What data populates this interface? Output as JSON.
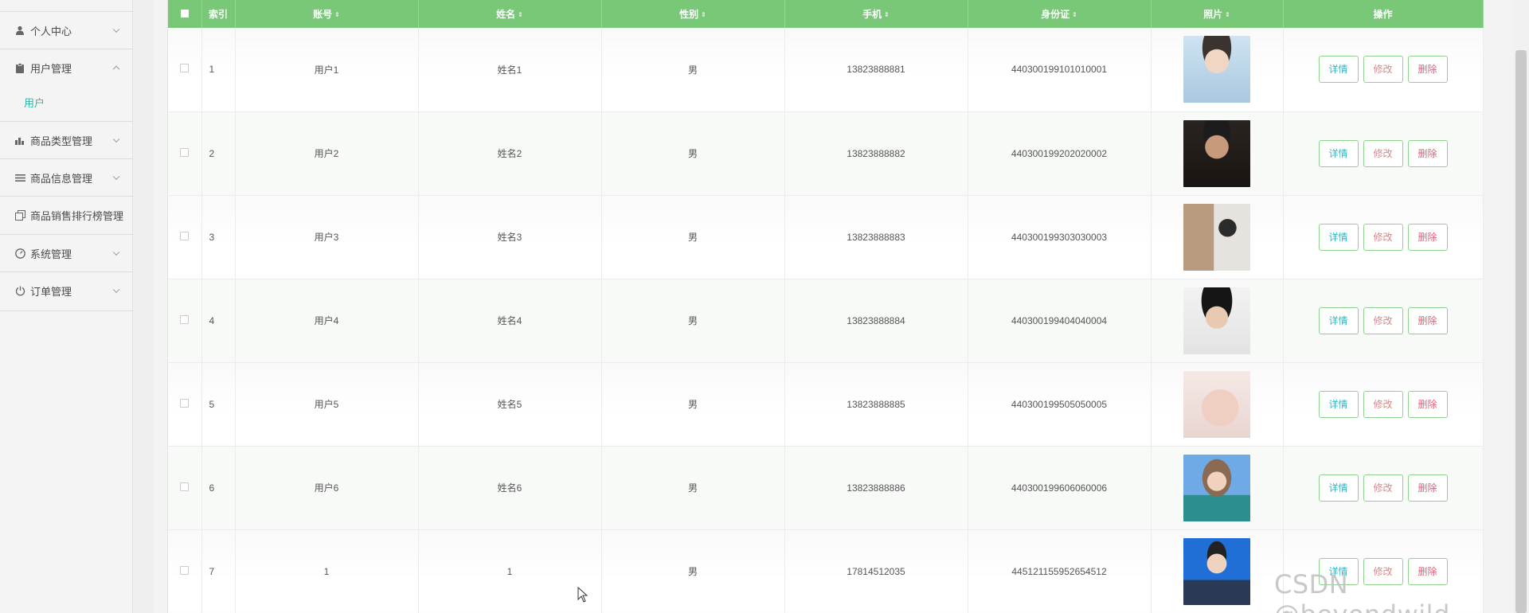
{
  "sidebar": {
    "items": [
      {
        "label": "个人中心",
        "icon": "user-icon"
      },
      {
        "label": "用户管理",
        "icon": "clipboard-icon",
        "expanded": true
      },
      {
        "label": "商品类型管理",
        "icon": "chart-icon"
      },
      {
        "label": "商品信息管理",
        "icon": "list-icon"
      },
      {
        "label": "商品销售排行榜管理",
        "icon": "copy-icon"
      },
      {
        "label": "系统管理",
        "icon": "dashboard-icon"
      },
      {
        "label": "订单管理",
        "icon": "power-icon"
      }
    ],
    "submenu": {
      "label": "用户"
    }
  },
  "table": {
    "headers": {
      "index": "索引",
      "account": "账号",
      "name": "姓名",
      "gender": "性别",
      "phone": "手机",
      "idcard": "身份证",
      "photo": "照片",
      "actions": "操作"
    },
    "buttons": {
      "detail": "详情",
      "edit": "修改",
      "delete": "删除"
    },
    "rows": [
      {
        "index": "1",
        "account": "用户1",
        "name": "姓名1",
        "gender": "男",
        "phone": "13823888881",
        "idcard": "440300199101010001"
      },
      {
        "index": "2",
        "account": "用户2",
        "name": "姓名2",
        "gender": "男",
        "phone": "13823888882",
        "idcard": "440300199202020002"
      },
      {
        "index": "3",
        "account": "用户3",
        "name": "姓名3",
        "gender": "男",
        "phone": "13823888883",
        "idcard": "440300199303030003"
      },
      {
        "index": "4",
        "account": "用户4",
        "name": "姓名4",
        "gender": "男",
        "phone": "13823888884",
        "idcard": "440300199404040004"
      },
      {
        "index": "5",
        "account": "用户5",
        "name": "姓名5",
        "gender": "男",
        "phone": "13823888885",
        "idcard": "440300199505050005"
      },
      {
        "index": "6",
        "account": "用户6",
        "name": "姓名6",
        "gender": "男",
        "phone": "13823888886",
        "idcard": "440300199606060006"
      },
      {
        "index": "7",
        "account": "1",
        "name": "1",
        "gender": "男",
        "phone": "17814512035",
        "idcard": "445121155952654512"
      }
    ]
  },
  "colors": {
    "header_bg": "#78c878",
    "submenu_active": "#2fb7a5",
    "button_border": "#8fd18f"
  },
  "watermark": "CSDN @beyondwild"
}
